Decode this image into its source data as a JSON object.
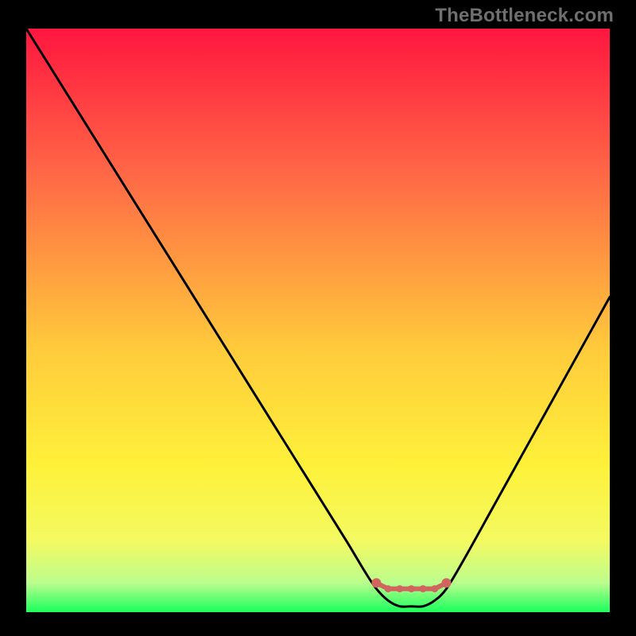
{
  "watermark": "TheBottleneck.com",
  "colors": {
    "frame": "#000000",
    "gradient_top": "#ff163f",
    "gradient_upper_mid": "#ff6846",
    "gradient_mid": "#ffcb3b",
    "gradient_lower_mid": "#fef13a",
    "gradient_low": "#f3fa62",
    "gradient_near_bottom": "#bbfd8e",
    "gradient_bottom": "#1aff5c",
    "curve": "#000000",
    "marker": "#d2645f"
  },
  "chart_data": {
    "type": "line",
    "title": "",
    "xlabel": "",
    "ylabel": "",
    "xlim": [
      0,
      100
    ],
    "ylim": [
      0,
      100
    ],
    "series": [
      {
        "name": "bottleneck-curve",
        "x": [
          0,
          5,
          10,
          15,
          20,
          25,
          30,
          35,
          40,
          45,
          50,
          55,
          58,
          60,
          62,
          64,
          66,
          68,
          70,
          72,
          75,
          80,
          85,
          90,
          95,
          100
        ],
        "values": [
          100,
          92,
          84,
          76,
          68,
          60,
          52,
          44,
          36,
          28,
          20,
          12,
          7,
          4,
          2,
          1,
          1,
          1,
          2,
          4,
          9,
          18,
          27,
          36,
          45,
          54
        ]
      }
    ],
    "markers": [
      {
        "x": 60,
        "y": 5
      },
      {
        "x": 62,
        "y": 4
      },
      {
        "x": 64,
        "y": 4
      },
      {
        "x": 66,
        "y": 4
      },
      {
        "x": 68,
        "y": 4
      },
      {
        "x": 70,
        "y": 4
      },
      {
        "x": 72,
        "y": 5
      }
    ],
    "annotations": []
  }
}
